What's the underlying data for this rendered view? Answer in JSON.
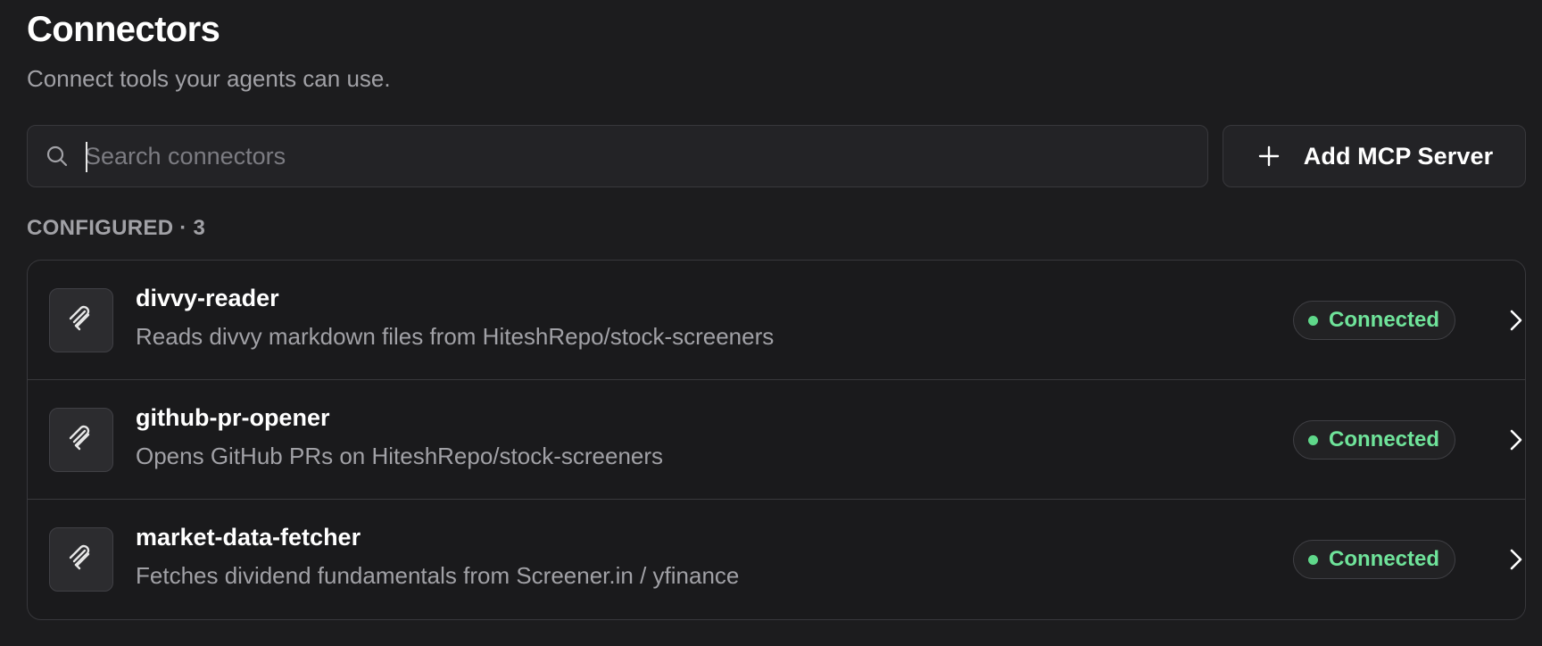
{
  "header": {
    "title": "Connectors",
    "subtitle": "Connect tools your agents can use."
  },
  "search": {
    "placeholder": "Search connectors",
    "value": "",
    "icon": "search-icon"
  },
  "toolbar": {
    "add_label": "Add MCP Server",
    "add_icon": "plus-icon"
  },
  "section": {
    "label": "CONFIGURED · 3"
  },
  "connectors": [
    {
      "name": "divvy-reader",
      "description": "Reads divvy markdown files from HiteshRepo/stock-screeners",
      "status": "Connected",
      "icon": "paperclip-icon"
    },
    {
      "name": "github-pr-opener",
      "description": "Opens GitHub PRs on HiteshRepo/stock-screeners",
      "status": "Connected",
      "icon": "paperclip-icon"
    },
    {
      "name": "market-data-fetcher",
      "description": "Fetches dividend fundamentals from Screener.in / yfinance",
      "status": "Connected",
      "icon": "paperclip-icon"
    }
  ],
  "colors": {
    "background": "#1c1c1e",
    "status_connected": "#6fe39a",
    "muted_text": "#a1a1a6",
    "border": "#38383c"
  }
}
